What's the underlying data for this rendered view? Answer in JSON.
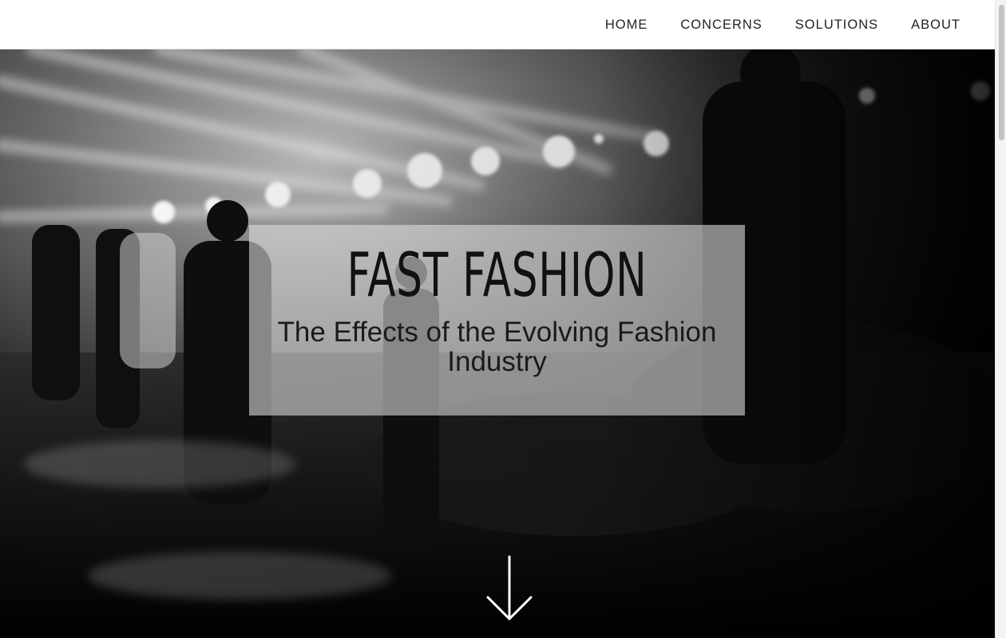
{
  "nav": {
    "items": [
      {
        "label": "HOME"
      },
      {
        "label": "CONCERNS"
      },
      {
        "label": "SOLUTIONS"
      },
      {
        "label": "ABOUT"
      }
    ]
  },
  "hero": {
    "title": "FAST FASHION",
    "subtitle": "The Effects of the Evolving Fashion Industry",
    "scroll_icon": "arrow-down-icon",
    "background": "black-and-white runway photo"
  },
  "colors": {
    "nav_bg": "#ffffff",
    "nav_text": "#222222",
    "title_text": "#111111"
  }
}
